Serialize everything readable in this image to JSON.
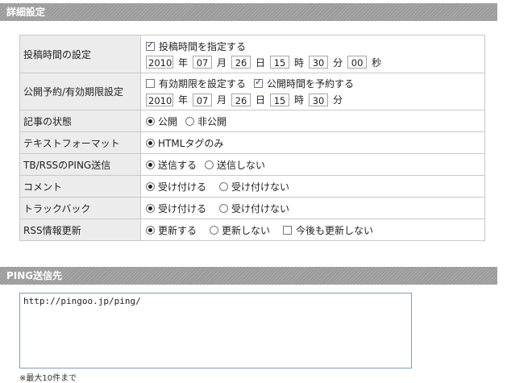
{
  "sections": {
    "detail_title": "詳細設定",
    "ping_title": "PING送信先"
  },
  "rows": {
    "post_time": {
      "label": "投稿時間の設定",
      "specify_label": "投稿時間を指定する",
      "specify_checked": true,
      "year": "2010",
      "year_unit": "年",
      "month": "07",
      "month_unit": "月",
      "day": "26",
      "day_unit": "日",
      "hour": "15",
      "hour_unit": "時",
      "minute": "30",
      "minute_unit": "分",
      "second": "00",
      "second_unit": "秒"
    },
    "schedule": {
      "label": "公開予約/有効期限設定",
      "expire_label": "有効期限を設定する",
      "expire_checked": false,
      "reserve_label": "公開時間を予約する",
      "reserve_checked": true,
      "year": "2010",
      "year_unit": "年",
      "month": "07",
      "month_unit": "月",
      "day": "26",
      "day_unit": "日",
      "hour": "15",
      "hour_unit": "時",
      "minute": "30",
      "minute_unit": "分"
    },
    "status": {
      "label": "記事の状態",
      "opt1": "公開",
      "opt2": "非公開",
      "selected": "公開"
    },
    "format": {
      "label": "テキストフォーマット",
      "opt1": "HTMLタグのみ",
      "selected": "HTMLタグのみ"
    },
    "ping": {
      "label": "TB/RSSのPING送信",
      "opt1": "送信する",
      "opt2": "送信しない",
      "selected": "送信する"
    },
    "comment": {
      "label": "コメント",
      "opt1": "受け付ける",
      "opt2": "受け付けない",
      "selected": "受け付ける"
    },
    "trackback": {
      "label": "トラックバック",
      "opt1": "受け付ける",
      "opt2": "受け付けない",
      "selected": "受け付ける"
    },
    "rss": {
      "label": "RSS情報更新",
      "opt1": "更新する",
      "opt2": "更新しない",
      "opt3": "今後も更新しない",
      "selected": "更新する",
      "opt3_checked": false
    }
  },
  "ping_box": {
    "value": "http://pingoo.jp/ping/",
    "note": "※最大10件まで"
  }
}
